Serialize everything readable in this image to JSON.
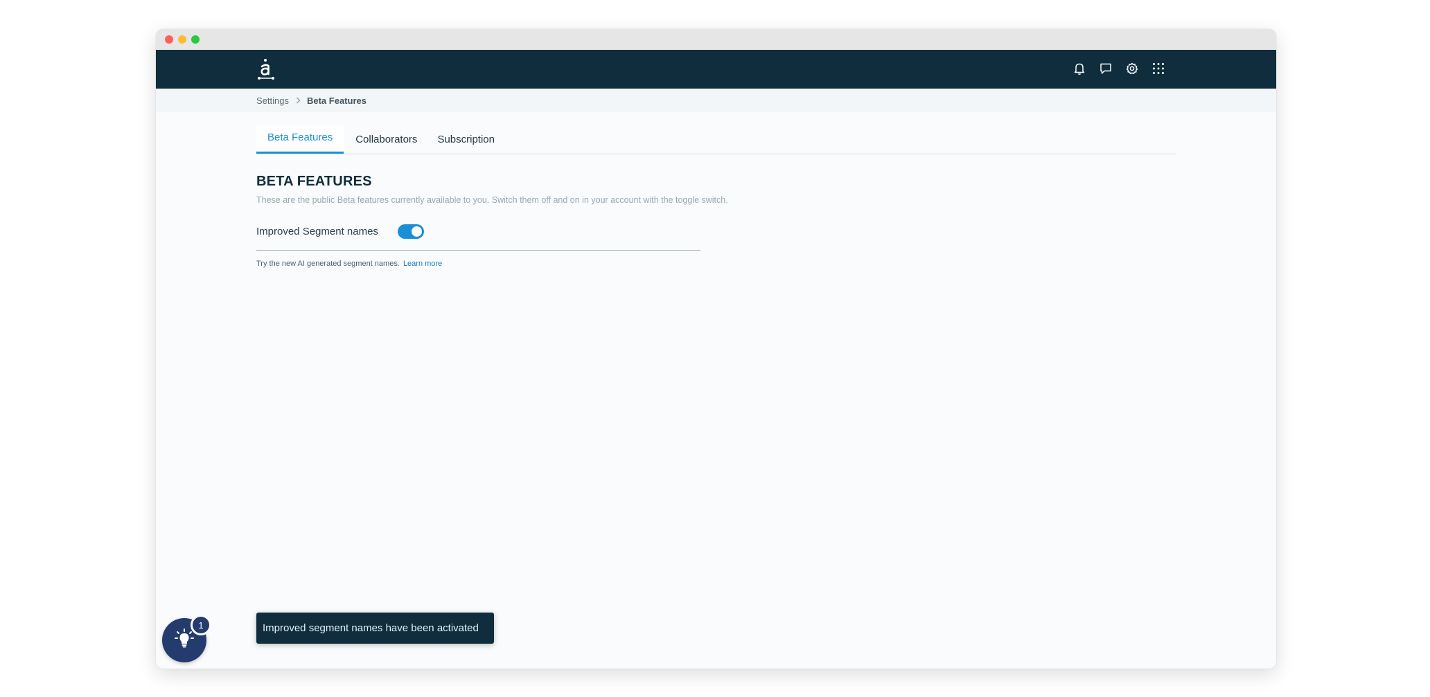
{
  "window": {
    "controls": [
      {
        "name": "close",
        "color": "#ff5f57"
      },
      {
        "name": "minimize",
        "color": "#febc2e"
      },
      {
        "name": "maximize",
        "color": "#28c840"
      }
    ]
  },
  "topnav": {
    "background": "#0f2d3c",
    "logo_icon": "app-logo-icon",
    "icons": [
      "notification-bell-icon",
      "chat-icon",
      "settings-gear-icon",
      "apps-grid-icon"
    ]
  },
  "breadcrumb": {
    "parent": "Settings",
    "current": "Beta Features"
  },
  "tabs": [
    {
      "label": "Beta Features",
      "active": true
    },
    {
      "label": "Collaborators",
      "active": false
    },
    {
      "label": "Subscription",
      "active": false
    }
  ],
  "section": {
    "title": "BETA FEATURES",
    "description": "These are the public Beta features currently available to you. Switch them off and on in your account with the toggle switch."
  },
  "feature": {
    "label": "Improved Segment names",
    "enabled": true,
    "help_text": "Try the new AI generated segment names.",
    "learn_more": "Learn more"
  },
  "toast": {
    "message": "Improved segment names have been activated"
  },
  "help_button": {
    "icon": "lightbulb-icon",
    "badge_count": "1"
  },
  "colors": {
    "accent": "#1a8fd6",
    "navy": "#0f2d3c",
    "fab": "#243b6e"
  }
}
